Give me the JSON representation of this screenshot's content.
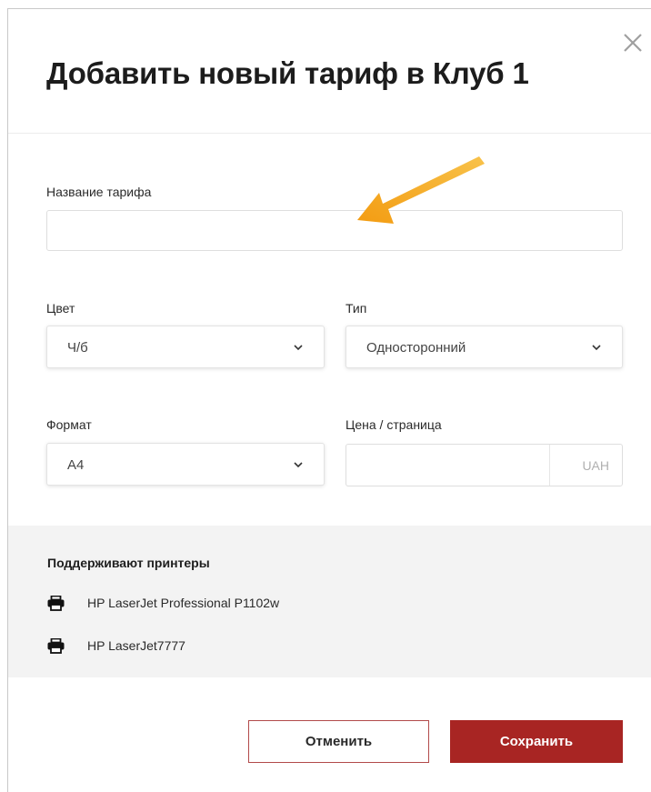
{
  "dialog": {
    "title": "Добавить новый тариф в Клуб 1",
    "close_icon": "close-icon"
  },
  "form": {
    "name": {
      "label": "Название тарифа",
      "value": "",
      "placeholder": ""
    },
    "color": {
      "label": "Цвет",
      "value": "Ч/б"
    },
    "type": {
      "label": "Тип",
      "value": "Односторонний"
    },
    "format": {
      "label": "Формат",
      "value": "А4"
    },
    "price": {
      "label": "Цена / страница",
      "value": "",
      "unit": "UAH"
    }
  },
  "printers": {
    "heading": "Поддерживают принтеры",
    "items": [
      {
        "name": "HP LaserJet Professional P1102w",
        "icon": "printer-icon"
      },
      {
        "name": "HP LaserJet7777",
        "icon": "printer-icon"
      }
    ]
  },
  "actions": {
    "cancel_label": "Отменить",
    "save_label": "Сохранить"
  },
  "colors": {
    "accent": "#a82523",
    "annotation_arrow": "#f5a623",
    "printers_bg": "#f3f3f3"
  }
}
